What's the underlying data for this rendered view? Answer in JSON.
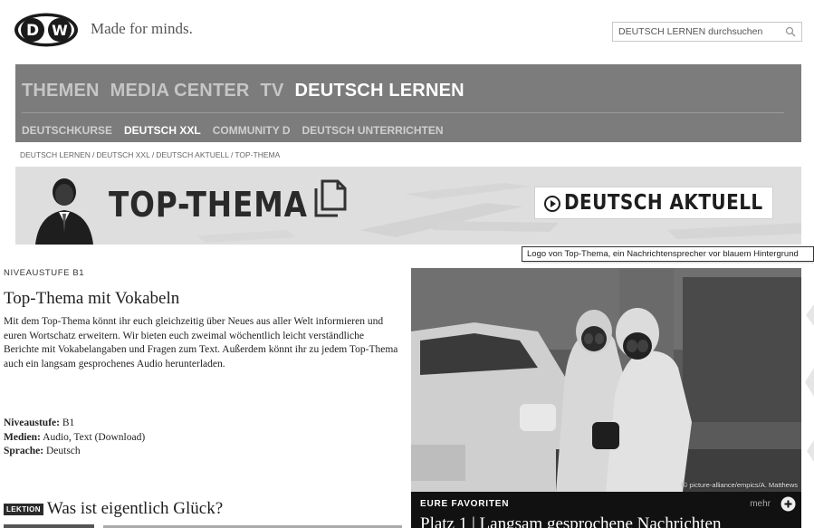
{
  "brand": {
    "tagline": "Made for minds.",
    "search_placeholder": "DEUTSCH LERNEN durchsuchen"
  },
  "nav": {
    "main": [
      {
        "label": "THEMEN",
        "active": false
      },
      {
        "label": "MEDIA CENTER",
        "active": false
      },
      {
        "label": "TV",
        "active": false
      },
      {
        "label": "DEUTSCH LERNEN",
        "active": true
      }
    ],
    "sub": [
      {
        "label": "DEUTSCHKURSE",
        "active": false
      },
      {
        "label": "DEUTSCH XXL",
        "active": true
      },
      {
        "label": "COMMUNITY D",
        "active": false
      },
      {
        "label": "DEUTSCH UNTERRICHTEN",
        "active": false
      }
    ]
  },
  "breadcrumb": [
    "DEUTSCH LERNEN",
    "DEUTSCH XXL",
    "DEUTSCH AKTUELL",
    "TOP-THEMA"
  ],
  "banner": {
    "title": "TOP-THEMA",
    "badge": "DEUTSCH AKTUELL",
    "tooltip": "Logo von Top-Thema, ein Nachrichtensprecher vor blauem Hintergrund"
  },
  "article": {
    "level_label": "NIVEAUSTUFE B1",
    "title": "Top-Thema mit Vokabeln",
    "intro": "Mit dem Top-Thema könnt ihr euch gleichzeitig über Neues aus aller Welt informieren und euren Wortschatz erweitern. Wir bieten euch zweimal wöchentlich leicht verständliche Berichte mit Vokabelangaben und Fragen zum Text. Außerdem könnt ihr zu jedem Top-Thema auch ein langsam gesprochenes Audio herunterladen.",
    "meta": [
      {
        "key": "Niveaustufe:",
        "value": "B1"
      },
      {
        "key": "Medien:",
        "value": "Audio, Text (Download)"
      },
      {
        "key": "Sprache:",
        "value": "Deutsch"
      }
    ],
    "lesson_badge": "LEKTION",
    "lesson_title": "Was ist eigentlich Glück?"
  },
  "photo": {
    "credit": "© picture-alliance/empics/A. Matthews"
  },
  "favorites": {
    "label": "EURE FAVORITEN",
    "more": "mehr",
    "title": "Platz 1 | Langsam gesprochene Nachrichten"
  },
  "colors": {
    "nav_bg": "#7c7c7c",
    "banner_bg": "#e0e0e0",
    "favorites_bg": "#111111"
  }
}
